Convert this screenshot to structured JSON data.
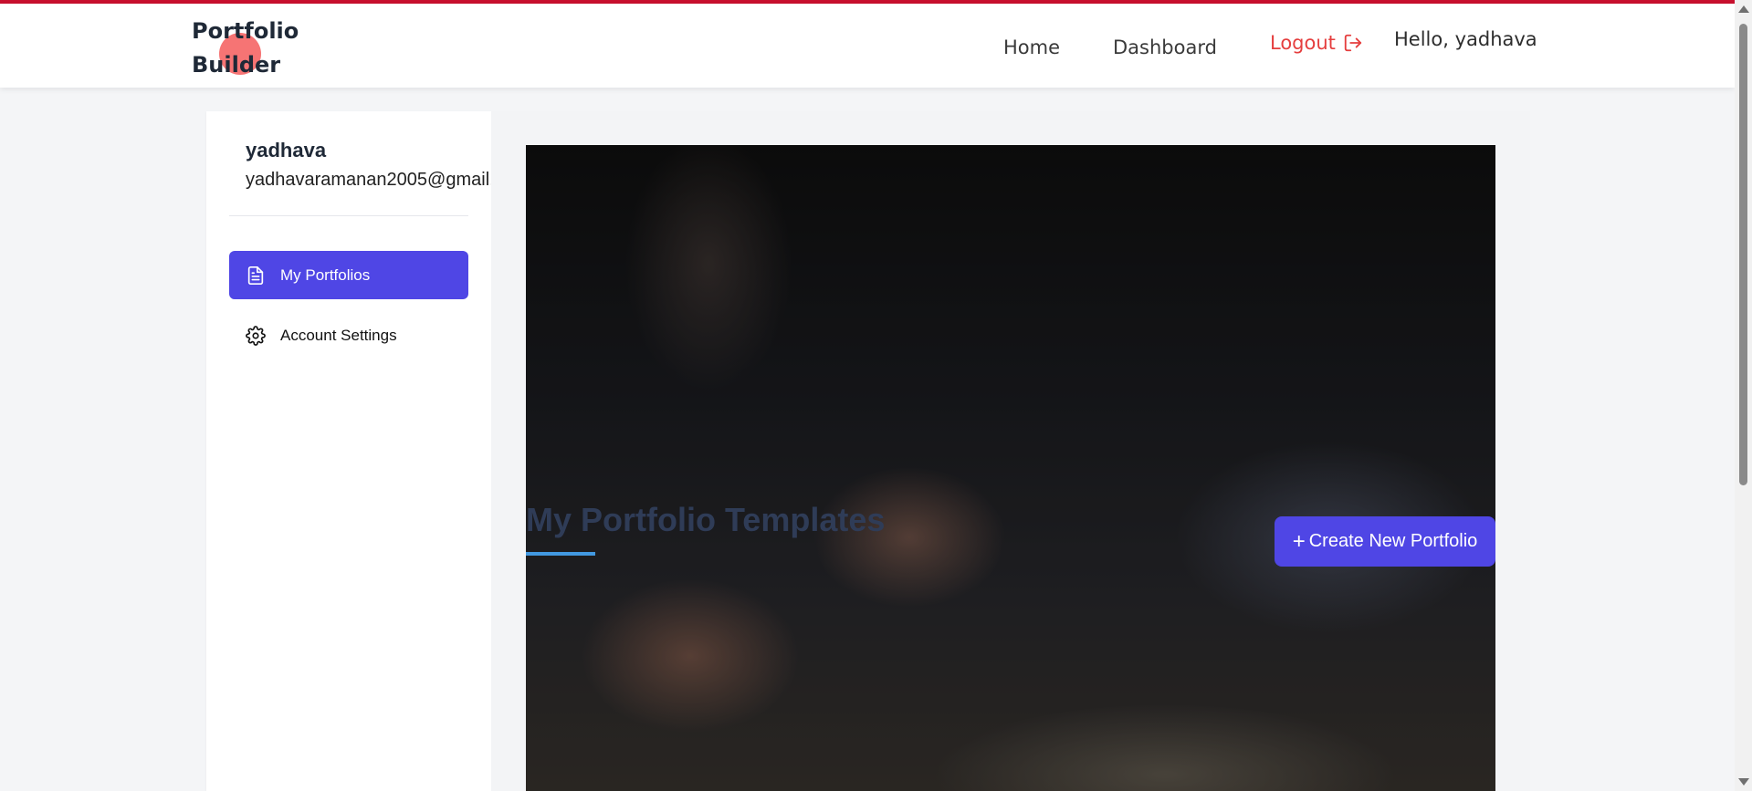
{
  "brand": {
    "line1": "Portfolio",
    "line2": "Builder"
  },
  "nav": {
    "home": "Home",
    "dashboard": "Dashboard",
    "logout": "Logout",
    "logout_icon": "logout-icon",
    "greeting": "Hello, yadhava"
  },
  "sidebar": {
    "user_name": "yadhava",
    "user_email": "yadhavaramanan2005@gmail.com",
    "items": [
      {
        "label": "My Portfolios",
        "icon": "document-icon",
        "active": true
      },
      {
        "label": "Account Settings",
        "icon": "gear-icon",
        "active": false
      }
    ]
  },
  "main": {
    "title": "My Portfolio Templates",
    "create_button": "Create New Portfolio",
    "create_icon": "plus-icon"
  },
  "colors": {
    "accent": "#4f46e5",
    "logout": "#e53e3e",
    "top_line": "#c8102e",
    "underline": "#4299e1"
  }
}
